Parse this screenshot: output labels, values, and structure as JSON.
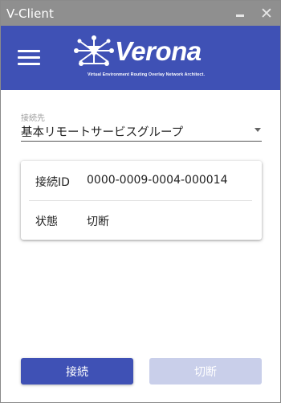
{
  "window": {
    "title": "V-Client",
    "minimize_icon": "minimize-icon",
    "close_glyph": "✕"
  },
  "header": {
    "menu_icon": "hamburger-menu-icon",
    "logo_name": "Verona",
    "logo_tagline": "Virtual Environment Routing Overlay Network Architect.",
    "background_color": "#3f51b5"
  },
  "connection_select": {
    "label": "接続先",
    "value": "基本リモートサービスグループ"
  },
  "status_card": {
    "rows": [
      {
        "key": "接続ID",
        "value": "0000-0009-0004-000014"
      },
      {
        "key": "状態",
        "value": "切断"
      }
    ]
  },
  "actions": {
    "connect_label": "接続",
    "disconnect_label": "切断",
    "connect_color": "#3f51b5",
    "disconnect_color": "#c9cfea"
  }
}
